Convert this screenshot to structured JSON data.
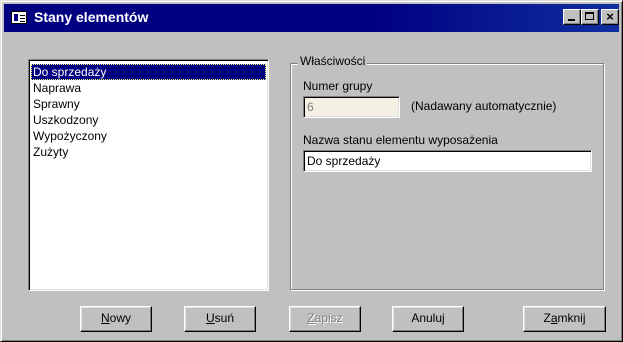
{
  "window": {
    "title": "Stany elementów",
    "icon": "list-window-icon",
    "controls": {
      "minimize": "minimize-icon",
      "maximize": "maximize-icon",
      "close": "close-icon"
    }
  },
  "list": {
    "items": [
      {
        "label": "Do sprzedaży",
        "selected": true
      },
      {
        "label": "Naprawa",
        "selected": false
      },
      {
        "label": "Sprawny",
        "selected": false
      },
      {
        "label": "Uszkodzony",
        "selected": false
      },
      {
        "label": "Wypożyczony",
        "selected": false
      },
      {
        "label": "Zużyty",
        "selected": false
      }
    ]
  },
  "properties": {
    "legend": "Właściwości",
    "group_number_label": "Numer grupy",
    "group_number_value": "6",
    "auto_note": "(Nadawany automatycznie)",
    "name_label": "Nazwa stanu elementu wyposażenia",
    "name_value": "Do sprzedaży"
  },
  "buttons": {
    "new": {
      "mnemonic": "N",
      "rest": "owy",
      "enabled": true
    },
    "delete": {
      "mnemonic": "U",
      "rest": "suń",
      "enabled": true
    },
    "save": {
      "mnemonic": "Z",
      "rest": "apisz",
      "enabled": false
    },
    "cancel": {
      "label": "Anuluj",
      "enabled": true
    },
    "close": {
      "pre": "Z",
      "mnemonic": "a",
      "rest": "mknij",
      "enabled": true
    }
  },
  "colors": {
    "titlebar": "#000080",
    "face": "#c0c0c0",
    "selection": "#000080"
  }
}
